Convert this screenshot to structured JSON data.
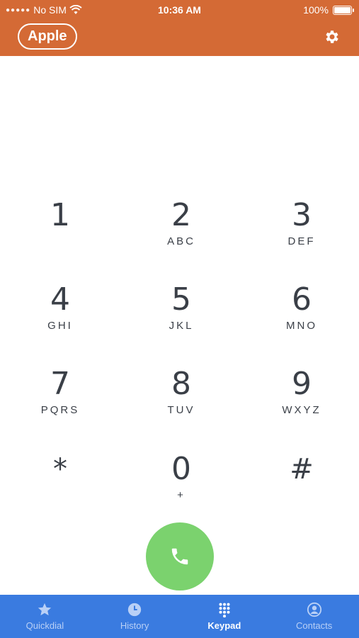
{
  "colors": {
    "header_bg": "#D46A35",
    "tabbar_bg": "#3A7BE0",
    "call_button": "#7BD26E",
    "digit_text": "#3a3f47"
  },
  "status_bar": {
    "carrier": "No SIM",
    "time": "10:36 AM",
    "battery_percent": "100%"
  },
  "header": {
    "account_label": "Apple",
    "settings_icon": "gear-icon"
  },
  "keypad": {
    "keys": [
      {
        "digit": "1",
        "letters": ""
      },
      {
        "digit": "2",
        "letters": "ABC"
      },
      {
        "digit": "3",
        "letters": "DEF"
      },
      {
        "digit": "4",
        "letters": "GHI"
      },
      {
        "digit": "5",
        "letters": "JKL"
      },
      {
        "digit": "6",
        "letters": "MNO"
      },
      {
        "digit": "7",
        "letters": "PQRS"
      },
      {
        "digit": "8",
        "letters": "TUV"
      },
      {
        "digit": "9",
        "letters": "WXYZ"
      },
      {
        "digit": "*",
        "letters": ""
      },
      {
        "digit": "0",
        "letters": "+"
      },
      {
        "digit": "#",
        "letters": ""
      }
    ],
    "call_icon": "phone-icon"
  },
  "tabs": [
    {
      "label": "Quickdial",
      "icon": "star-icon",
      "active": false
    },
    {
      "label": "History",
      "icon": "clock-icon",
      "active": false
    },
    {
      "label": "Keypad",
      "icon": "keypad-grid-icon",
      "active": true
    },
    {
      "label": "Contacts",
      "icon": "contact-icon",
      "active": false
    }
  ]
}
